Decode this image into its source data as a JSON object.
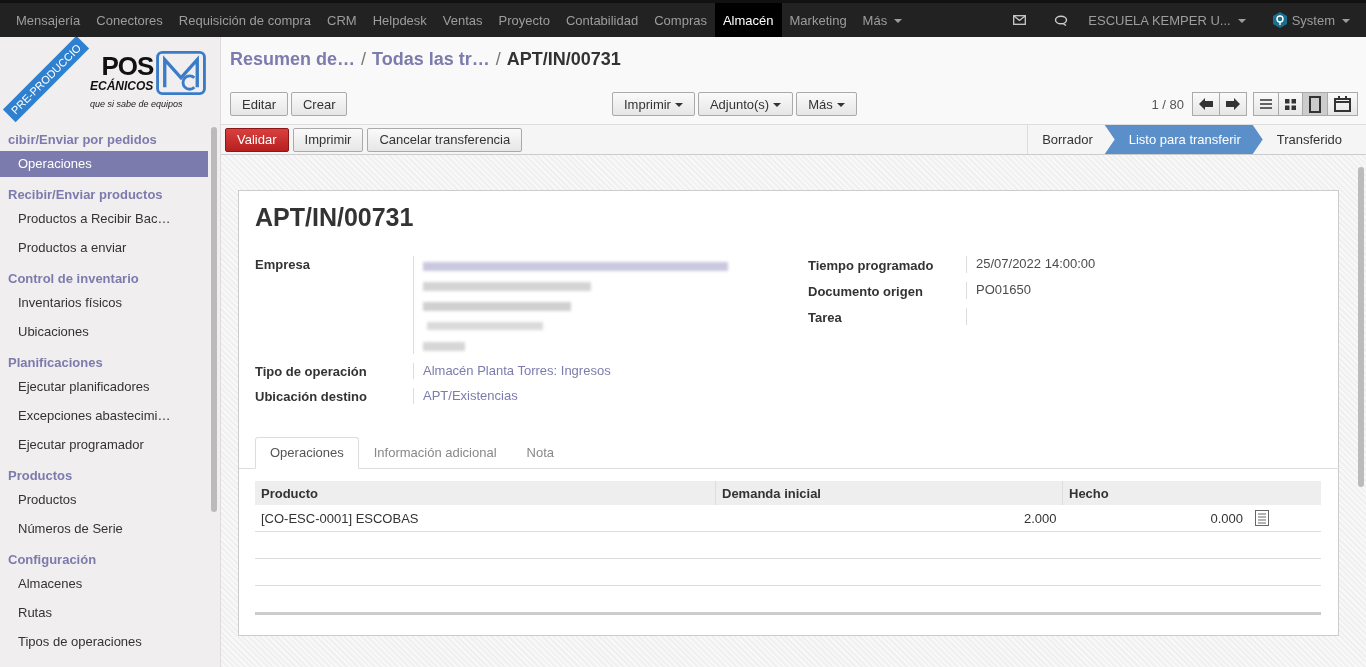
{
  "top_menu": [
    {
      "label": "Mensajería",
      "selected": false
    },
    {
      "label": "Conectores",
      "selected": false
    },
    {
      "label": "Requisición de compra",
      "selected": false
    },
    {
      "label": "CRM",
      "selected": false
    },
    {
      "label": "Helpdesk",
      "selected": false
    },
    {
      "label": "Ventas",
      "selected": false
    },
    {
      "label": "Proyecto",
      "selected": false
    },
    {
      "label": "Contabilidad",
      "selected": false
    },
    {
      "label": "Compras",
      "selected": false
    },
    {
      "label": "Almacén",
      "selected": true
    },
    {
      "label": "Marketing",
      "selected": false
    },
    {
      "label": "Más",
      "selected": false
    }
  ],
  "systray": {
    "company": "ESCUELA KEMPER U...",
    "user": "System"
  },
  "logo": {
    "line1": "POS",
    "line2": "ECÁNICOS",
    "tagline": "que si sabe de equipos"
  },
  "ribbon": "PRE-PRODUCCIO",
  "sidebar": [
    {
      "heading": "cibir/Enviar por pedidos",
      "items": [
        {
          "label": "Operaciones",
          "selected": true
        }
      ]
    },
    {
      "heading": "Recibir/Enviar productos",
      "items": [
        {
          "label": "Productos a Recibir Bac…",
          "selected": false
        },
        {
          "label": "Productos a enviar",
          "selected": false
        }
      ]
    },
    {
      "heading": "Control de inventario",
      "items": [
        {
          "label": "Inventarios físicos",
          "selected": false
        },
        {
          "label": "Ubicaciones",
          "selected": false
        }
      ]
    },
    {
      "heading": "Planificaciones",
      "items": [
        {
          "label": "Ejecutar planificadores",
          "selected": false
        },
        {
          "label": "Excepciones abastecimi…",
          "selected": false
        },
        {
          "label": "Ejecutar programador",
          "selected": false
        }
      ]
    },
    {
      "heading": "Productos",
      "items": [
        {
          "label": "Productos",
          "selected": false
        },
        {
          "label": "Números de Serie",
          "selected": false
        }
      ]
    },
    {
      "heading": "Configuración",
      "items": [
        {
          "label": "Almacenes",
          "selected": false
        },
        {
          "label": "Rutas",
          "selected": false
        },
        {
          "label": "Tipos de operaciones",
          "selected": false
        }
      ]
    }
  ],
  "breadcrumbs": [
    {
      "label": "Resumen de…"
    },
    {
      "separator": "/",
      "label": "Todas las tr…"
    },
    {
      "separator": "/",
      "label": "APT/IN/00731"
    }
  ],
  "main_buttons": [
    "Editar",
    "Crear"
  ],
  "dropdown_buttons": [
    "Imprimir",
    "Adjunto(s)",
    "Más"
  ],
  "pager": "1 / 80",
  "views": [
    {
      "kind": "list",
      "selected": false
    },
    {
      "kind": "kanban",
      "selected": false
    },
    {
      "kind": "form",
      "selected": true
    },
    {
      "kind": "calendar",
      "selected": false
    }
  ],
  "header_buttons": [
    {
      "label": "Validar",
      "kind": "primary"
    },
    {
      "label": "Imprimir",
      "kind": "default"
    },
    {
      "label": "Cancelar transferencia",
      "kind": "default"
    }
  ],
  "statusbar": [
    {
      "label": "Borrador",
      "selected": false
    },
    {
      "label": "Listo para transferir",
      "selected": true
    },
    {
      "label": "Transferido",
      "selected": false
    }
  ],
  "title": "APT/IN/00731",
  "left_fields": [
    {
      "label": "Empresa",
      "kind": "redacted"
    },
    {
      "label": "Tipo de operación",
      "kind": "link",
      "value": "Almacén Planta Torres: Ingresos"
    },
    {
      "label": "Ubicación destino",
      "kind": "link",
      "value": "APT/Existencias"
    }
  ],
  "right_fields": [
    {
      "label": "Tiempo programado",
      "value": "25/07/2022 14:00:00"
    },
    {
      "label": "Documento origen",
      "value": "PO01650"
    },
    {
      "label": "Tarea"
    }
  ],
  "tabs": [
    {
      "label": "Operaciones",
      "selected": true
    },
    {
      "label": "Información adicional",
      "selected": false
    },
    {
      "label": "Nota",
      "selected": false
    }
  ],
  "table": {
    "columns": [
      "Producto",
      "Demanda inicial",
      "Hecho"
    ],
    "rows": [
      {
        "product": "[CO-ESC-0001] ESCOBAS",
        "demand": "2.000",
        "done": "0.000"
      }
    ]
  }
}
